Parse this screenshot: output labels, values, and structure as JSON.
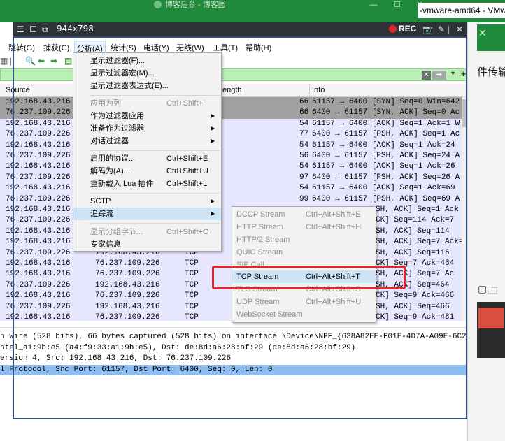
{
  "background_window": {
    "title": "博客后台 - 博客园",
    "min": "—",
    "max": "☐",
    "close": "✕",
    "vm_tab": "-vmware-amd64 - VMwar",
    "side_text": "件传输"
  },
  "recorder": {
    "size": "944x798",
    "rec_label": "REC"
  },
  "menubar": [
    {
      "label": "跳转(G)"
    },
    {
      "label": "捕获(C)"
    },
    {
      "label": "分析(A)"
    },
    {
      "label": "统计(S)"
    },
    {
      "label": "电话(Y)"
    },
    {
      "label": "无线(W)"
    },
    {
      "label": "工具(T)"
    },
    {
      "label": "帮助(H)"
    }
  ],
  "columns": {
    "source": "Source",
    "length": "ength",
    "info": "Info"
  },
  "packets": [
    {
      "src": "192.168.43.216",
      "len": "66",
      "info": "61157 → 6400 [SYN] Seq=0 Win=642"
    },
    {
      "src": "76.237.109.226",
      "len": "66",
      "info": "6400 → 61157 [SYN, ACK] Seq=0 Ac"
    },
    {
      "src": "192.168.43.216",
      "len": "54",
      "info": "61157 → 6400 [ACK] Seq=1 Ack=1 W"
    },
    {
      "src": "76.237.109.226",
      "len": "77",
      "info": "6400 → 61157 [PSH, ACK] Seq=1 Ac"
    },
    {
      "src": "192.168.43.216",
      "len": "54",
      "info": "61157 → 6400 [ACK] Seq=1 Ack=24"
    },
    {
      "src": "76.237.109.226",
      "len": "56",
      "info": "6400 → 61157 [PSH, ACK] Seq=24 A"
    },
    {
      "src": "192.168.43.216",
      "len": "54",
      "info": "61157 → 6400 [ACK] Seq=1 Ack=26"
    },
    {
      "src": "76.237.109.226",
      "len": "97",
      "info": "6400 → 61157 [PSH, ACK] Seq=26 A"
    },
    {
      "src": "192.168.43.216",
      "len": "54",
      "info": "61157 → 6400 [ACK] Seq=1 Ack=69"
    },
    {
      "src": "76.237.109.226",
      "len": "99",
      "info": "6400 → 61157 [PSH, ACK] Seq=69 A"
    },
    {
      "src": "192.168.43.216",
      "dst": "",
      "proto": "",
      "info_tail": "SH, ACK] Seq=1 Ack"
    },
    {
      "src": "76.237.109.226",
      "info_tail": "CK] Seq=114 Ack=7"
    },
    {
      "src": "192.168.43.216",
      "info_tail": "SH, ACK] Seq=114"
    },
    {
      "src": "192.168.43.216",
      "info_tail": "SH, ACK] Seq=7 Ack=116"
    },
    {
      "src": "76.237.109.226",
      "dst": "192.168.43.216",
      "proto": "TCP",
      "info_tail": "SH, ACK] Seq=116"
    },
    {
      "src": "192.168.43.216",
      "dst": "76.237.109.226",
      "proto": "TCP",
      "info_tail": "CK] Seq=7 Ack=464"
    },
    {
      "src": "192.168.43.216",
      "dst": "76.237.109.226",
      "proto": "TCP",
      "info_tail": "SH, ACK] Seq=7 Ac"
    },
    {
      "src": "76.237.109.226",
      "dst": "192.168.43.216",
      "proto": "TCP",
      "info_tail": "SH, ACK] Seq=464"
    },
    {
      "src": "192.168.43.216",
      "dst": "76.237.109.226",
      "proto": "TCP",
      "info_tail": "CK] Seq=9 Ack=466"
    },
    {
      "src": "76.237.109.226",
      "dst": "192.168.43.216",
      "proto": "TCP",
      "info_tail": "SH, ACK] Seq=466"
    },
    {
      "src": "192.168.43.216",
      "dst": "76.237.109.226",
      "proto": "TCP",
      "info_tail": "CK] Seq=9 Ack=481"
    }
  ],
  "details": [
    "n wire (528 bits), 66 bytes captured (528 bits) on interface \\Device\\NPF_{638A82EE-F01E-4D7A-A09E-6C2F586C7FC",
    "ntel_a1:9b:e5 (a4:f9:33:a1:9b:e5), Dst: de:8d:a6:28:bf:29 (de:8d:a6:28:bf:29)",
    "ersion 4, Src: 192.168.43.216, Dst: 76.237.109.226",
    "l Protocol, Src Port: 61157, Dst Port: 6400, Seq: 0, Len: 0"
  ],
  "analyze_menu": {
    "display_filters": "显示过滤器(F)...",
    "display_filter_macros": "显示过滤器宏(M)...",
    "display_filter_expression": "显示过滤器表达式(E)...",
    "apply_as_column": "应用为列",
    "apply_as_column_sc": "Ctrl+Shift+I",
    "apply_as_filter": "作为过滤器应用",
    "prepare_as_filter": "准备作为过滤器",
    "conversation_filter": "对话过滤器",
    "enabled_protocols": "启用的协议...",
    "enabled_protocols_sc": "Ctrl+Shift+E",
    "decode_as": "解码为(A)...",
    "decode_as_sc": "Ctrl+Shift+U",
    "reload_lua": "重新载入 Lua 插件",
    "reload_lua_sc": "Ctrl+Shift+L",
    "sctp": "SCTP",
    "follow": "追踪流",
    "show_packet_bytes": "显示分组字节...",
    "show_packet_bytes_sc": "Ctrl+Shift+O",
    "expert_info": "专家信息"
  },
  "follow_submenu": [
    {
      "label": "DCCP Stream",
      "sc": "Ctrl+Alt+Shift+E",
      "enabled": false
    },
    {
      "label": "HTTP Stream",
      "sc": "Ctrl+Alt+Shift+H",
      "enabled": false
    },
    {
      "label": "HTTP/2 Stream",
      "sc": "",
      "enabled": false
    },
    {
      "label": "QUIC Stream",
      "sc": "",
      "enabled": false
    },
    {
      "label": "SIP Call",
      "sc": "",
      "enabled": false
    },
    {
      "label": "TCP Stream",
      "sc": "Ctrl+Alt+Shift+T",
      "enabled": true,
      "highlighted": true
    },
    {
      "label": "TLS Stream",
      "sc": "Ctrl+Alt+Shift+S",
      "enabled": false
    },
    {
      "label": "UDP Stream",
      "sc": "Ctrl+Alt+Shift+U",
      "enabled": false
    },
    {
      "label": "WebSocket Stream",
      "sc": "",
      "enabled": false
    }
  ],
  "colors": {
    "filter_bar": "#b9f0b4",
    "row_lavender": "#e7e6ff",
    "row_selected_gray": "#a0a0a0",
    "detail_selected": "#8fbdf0",
    "menu_highlight": "#cde4f7",
    "annotation_red": "#e8242a",
    "rec_red": "#e02727"
  }
}
